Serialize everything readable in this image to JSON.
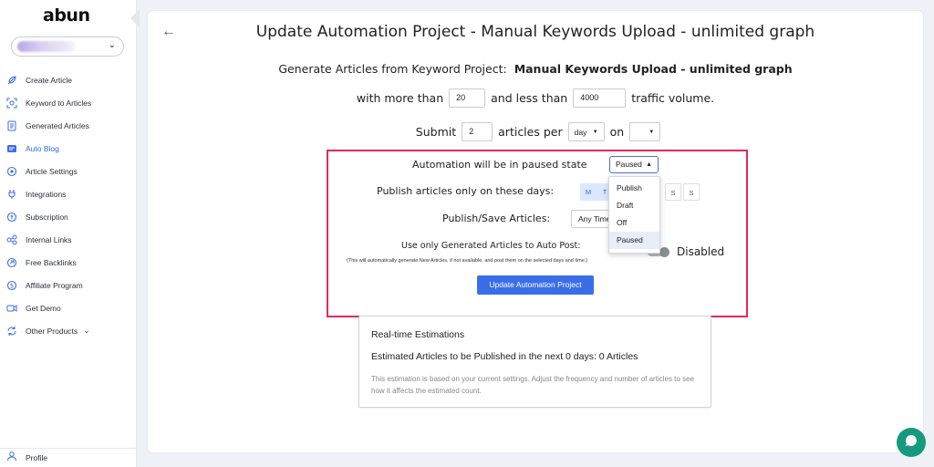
{
  "sidebar": {
    "logo": "abun",
    "items": [
      {
        "label": "Create Article",
        "icon": "feather-icon"
      },
      {
        "label": "Keyword to Articles",
        "icon": "keyword-scan-icon"
      },
      {
        "label": "Generated Articles",
        "icon": "document-icon"
      },
      {
        "label": "Auto Blog",
        "icon": "auto-blog-icon",
        "active": true
      },
      {
        "label": "Article Settings",
        "icon": "settings-icon"
      },
      {
        "label": "Integrations",
        "icon": "plug-icon"
      },
      {
        "label": "Subscription",
        "icon": "subscription-icon"
      },
      {
        "label": "Internal Links",
        "icon": "link-icon"
      },
      {
        "label": "Free Backlinks",
        "icon": "backlink-icon"
      },
      {
        "label": "Affiliate Program",
        "icon": "dollar-icon"
      },
      {
        "label": "Get Demo",
        "icon": "video-icon"
      },
      {
        "label": "Other Products",
        "icon": "refresh-icon"
      }
    ],
    "profile": "Profile"
  },
  "main": {
    "title": "Update Automation Project - Manual Keywords Upload - unlimited graph",
    "generate_prefix": "Generate Articles from Keyword Project:",
    "project_name": "Manual Keywords Upload - unlimited graph",
    "traffic": {
      "prefix": "with more than",
      "min": "20",
      "middle": "and less than",
      "max": "4000",
      "suffix": "traffic volume."
    },
    "submit": {
      "prefix": "Submit",
      "count": "2",
      "middle": "articles per",
      "period": "day",
      "on": "on",
      "on_value": ""
    },
    "automation_state_label": "Automation will be in paused state",
    "automation_state_value": "Paused",
    "state_options": [
      "Publish",
      "Draft",
      "Off",
      "Paused"
    ],
    "selected_option": "Paused",
    "publish_days_label": "Publish articles only on these days:",
    "days_visible_left": [
      "M",
      "T"
    ],
    "days_visible_right": [
      "S",
      "S"
    ],
    "publish_save_label": "Publish/Save Articles:",
    "publish_save_value": "Any Time",
    "generated_only_label": "Use only Generated Articles to Auto Post:",
    "generated_only_status": "Disabled",
    "note": "(This will automatically generate New Articles, if not available, and post them on the selected days and time.)",
    "update_button": "Update Automation Project"
  },
  "estimations": {
    "title": "Real-time Estimations",
    "count_text": "Estimated Articles to be Published in the next 0 days: 0 Articles",
    "description": "This estimation is based on your current settings. Adjust the frequency and number of articles to see how it affects the estimated count."
  },
  "colors": {
    "accent": "#3a6ee8",
    "highlight": "#e2285d",
    "chat": "#159a7d"
  }
}
